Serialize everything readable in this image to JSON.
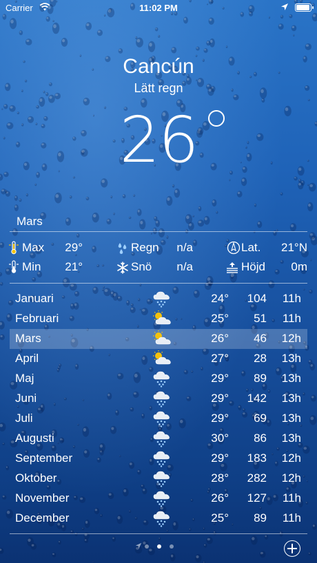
{
  "status_bar": {
    "carrier": "Carrier",
    "time": "11:02 PM",
    "battery_level": 1.0
  },
  "location": {
    "city": "Cancún",
    "condition": "Lätt regn",
    "temperature": "26",
    "temperature_unit": "°"
  },
  "selected_month_label": "Mars",
  "stats": {
    "max_label": "Max",
    "max_value": "29°",
    "min_label": "Min",
    "min_value": "21°",
    "rain_label": "Regn",
    "rain_value": "n/a",
    "snow_label": "Snö",
    "snow_value": "n/a",
    "lat_label": "Lat.",
    "lat_value": "21°N",
    "altitude_label": "Höjd",
    "altitude_value": "0m"
  },
  "months": [
    {
      "name": "Januari",
      "icon": "cloud-rain-icon",
      "temp": "24°",
      "precip": "104",
      "hours": "11h"
    },
    {
      "name": "Februari",
      "icon": "partly-cloudy-icon",
      "temp": "25°",
      "precip": "51",
      "hours": "11h"
    },
    {
      "name": "Mars",
      "icon": "partly-cloudy-icon",
      "temp": "26°",
      "precip": "46",
      "hours": "12h",
      "selected": true
    },
    {
      "name": "April",
      "icon": "partly-cloudy-icon",
      "temp": "27°",
      "precip": "28",
      "hours": "13h"
    },
    {
      "name": "Maj",
      "icon": "cloud-rain-icon",
      "temp": "29°",
      "precip": "89",
      "hours": "13h"
    },
    {
      "name": "Juni",
      "icon": "cloud-rain-icon",
      "temp": "29°",
      "precip": "142",
      "hours": "13h"
    },
    {
      "name": "Juli",
      "icon": "cloud-rain-icon",
      "temp": "29°",
      "precip": "69",
      "hours": "13h"
    },
    {
      "name": "Augusti",
      "icon": "cloud-rain-icon",
      "temp": "30°",
      "precip": "86",
      "hours": "13h"
    },
    {
      "name": "September",
      "icon": "cloud-rain-icon",
      "temp": "29°",
      "precip": "183",
      "hours": "12h"
    },
    {
      "name": "Oktober",
      "icon": "cloud-rain-icon",
      "temp": "28°",
      "precip": "282",
      "hours": "12h"
    },
    {
      "name": "November",
      "icon": "cloud-rain-icon",
      "temp": "26°",
      "precip": "127",
      "hours": "11h"
    },
    {
      "name": "December",
      "icon": "cloud-rain-icon",
      "temp": "25°",
      "precip": "89",
      "hours": "11h"
    }
  ],
  "pager": {
    "page_count": 3,
    "active_page": 2,
    "first_is_location": true
  },
  "colors": {
    "background_top": "#2a74c7",
    "background_bottom": "#0b3273",
    "text": "#ffffff",
    "sun": "#f4c20d",
    "thermometer": "#f4c20d",
    "rain_drop": "#9fd0ff"
  }
}
